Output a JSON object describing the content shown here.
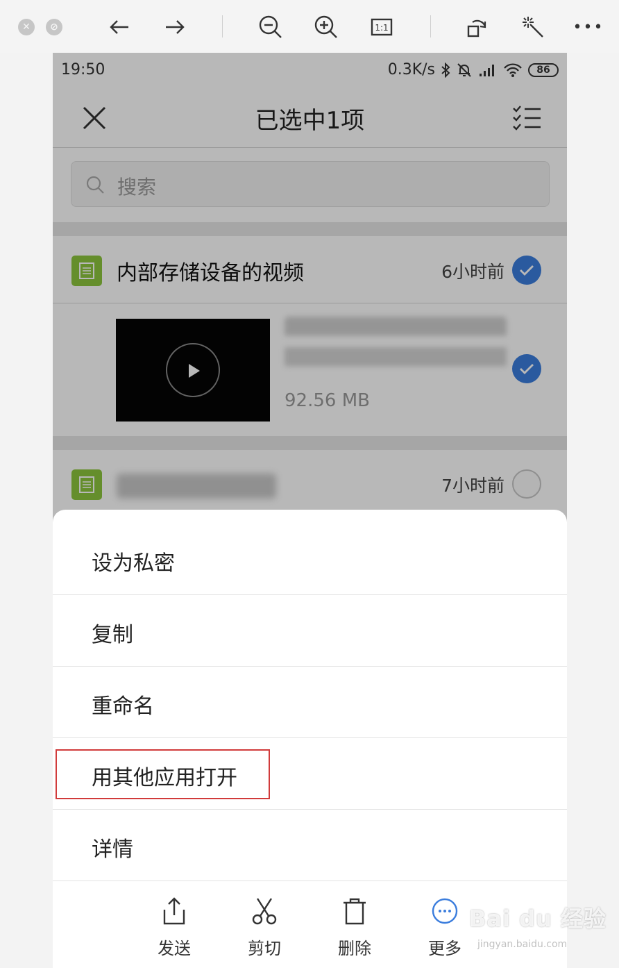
{
  "viewer": {
    "icons": [
      "close-window-icon",
      "minimize-window-icon",
      "back-arrow-icon",
      "forward-arrow-icon",
      "zoom-out-icon",
      "zoom-in-icon",
      "actual-size-icon",
      "rotate-icon",
      "magic-wand-icon",
      "more-icon"
    ],
    "actual_size_label": "1:1",
    "more_label": "•••"
  },
  "status_bar": {
    "time": "19:50",
    "speed": "0.3K/s",
    "battery": "86"
  },
  "header": {
    "title": "已选中1项"
  },
  "search": {
    "placeholder": "搜索"
  },
  "groups": [
    {
      "title": "内部存储设备的视频",
      "time": "6小时前",
      "checked": true
    },
    {
      "title": "",
      "time": "7小时前",
      "checked": false
    }
  ],
  "file": {
    "size": "92.56 MB",
    "checked": true
  },
  "menu": {
    "items": [
      {
        "label": "设为私密"
      },
      {
        "label": "复制"
      },
      {
        "label": "重命名"
      },
      {
        "label": "用其他应用打开",
        "highlighted": true
      },
      {
        "label": "详情"
      }
    ]
  },
  "actions": [
    {
      "label": "发送",
      "icon": "share-icon"
    },
    {
      "label": "剪切",
      "icon": "scissors-icon"
    },
    {
      "label": "删除",
      "icon": "trash-icon"
    },
    {
      "label": "更多",
      "icon": "more-circle-icon",
      "color": "#3b7ddd"
    }
  ],
  "colors": {
    "accent": "#3b7ddd",
    "doc_icon": "#8dc53e",
    "highlight": "#d13b3b"
  },
  "watermark": {
    "text": "Bai du 经验",
    "sub": "jingyan.baidu.com"
  }
}
